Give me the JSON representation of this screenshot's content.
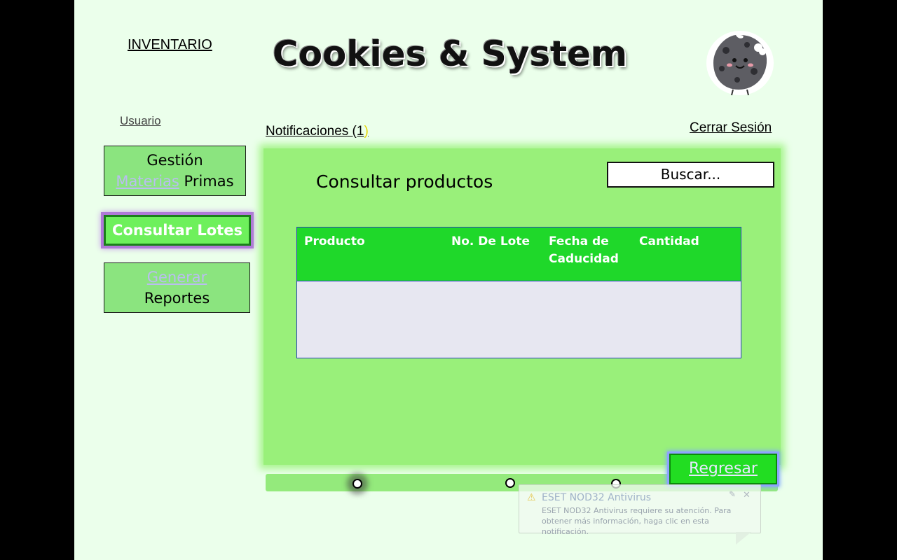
{
  "header": {
    "inventario_link": "INVENTARIO",
    "app_title": "Cookies & System",
    "logo_icon": "cookie-mascot-icon"
  },
  "user": {
    "usuario_link": "Usuario",
    "notifications": "Notificaciones (1",
    "notifications_close": ")",
    "logout": "Cerrar Sesión"
  },
  "sidebar": {
    "gestion": {
      "line1": "Gestión",
      "word_faded": "Materias",
      "word_rest": " Primas"
    },
    "lotes": "Consultar Lotes",
    "reportes": {
      "word_faded": "Generar",
      "line2": "Reportes"
    }
  },
  "main": {
    "title": "Consultar productos",
    "search_placeholder": "Buscar...",
    "table": {
      "columns": [
        "Producto",
        "No. De Lote",
        "Fecha de Caducidad",
        "Cantidad"
      ],
      "rows": []
    },
    "back_button": "Regresar"
  },
  "colors": {
    "slide_bg": "#ebffeb",
    "panel_bg": "#99f07a",
    "table_header": "#1fd82a",
    "accent_green": "#22dd22"
  },
  "notification_popup": {
    "title": "ESET NOD32 Antivirus",
    "body": "ESET NOD32 Antivirus requiere su atención. Para obtener más información, haga clic en esta notificación.",
    "warn_icon": "warning-icon",
    "close_icon": "close-icon",
    "pin_icon": "pin-icon"
  }
}
